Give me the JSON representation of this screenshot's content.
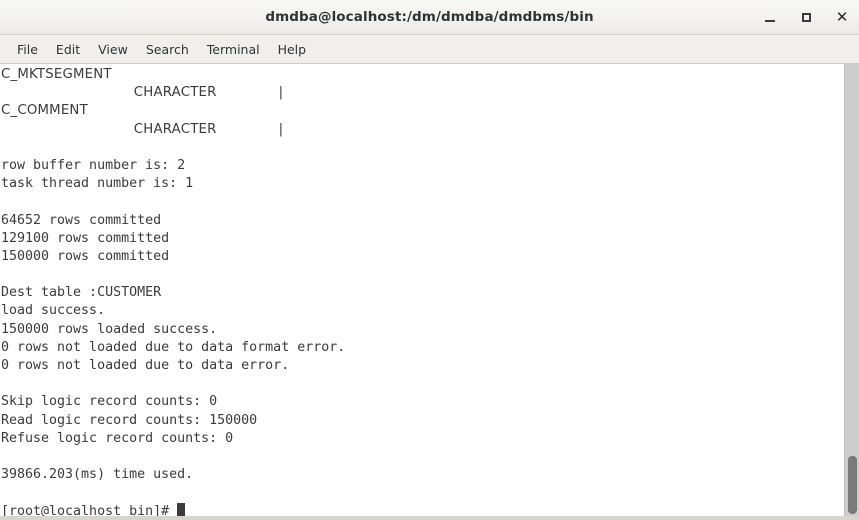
{
  "window": {
    "title": "dmdba@localhost:/dm/dmdba/dmdbms/bin",
    "controls": {
      "minimize": "–",
      "maximize": "□",
      "close": "✕"
    }
  },
  "menubar": {
    "items": [
      {
        "label": "File"
      },
      {
        "label": "Edit"
      },
      {
        "label": "View"
      },
      {
        "label": "Search"
      },
      {
        "label": "Terminal"
      },
      {
        "label": "Help"
      }
    ]
  },
  "terminal": {
    "lines": [
      {
        "text": "C_MKTSEGMENT",
        "style": "hdr"
      },
      {
        "text": "                              CHARACTER              |",
        "style": "hdr"
      },
      {
        "text": "C_COMMENT",
        "style": "hdr"
      },
      {
        "text": "                              CHARACTER              |",
        "style": "hdr"
      },
      {
        "text": "",
        "style": "blank"
      },
      {
        "text": "row buffer number is: 2",
        "style": "mono"
      },
      {
        "text": "task thread number is: 1",
        "style": "mono"
      },
      {
        "text": "",
        "style": "blank"
      },
      {
        "text": "64652 rows committed",
        "style": "mono"
      },
      {
        "text": "129100 rows committed",
        "style": "mono"
      },
      {
        "text": "150000 rows committed",
        "style": "mono"
      },
      {
        "text": "",
        "style": "blank"
      },
      {
        "text": "Dest table :CUSTOMER",
        "style": "mono"
      },
      {
        "text": "load success.",
        "style": "mono"
      },
      {
        "text": "150000 rows loaded success.",
        "style": "mono"
      },
      {
        "text": "0 rows not loaded due to data format error.",
        "style": "mono"
      },
      {
        "text": "0 rows not loaded due to data error.",
        "style": "mono"
      },
      {
        "text": "",
        "style": "blank"
      },
      {
        "text": "Skip logic record counts: 0",
        "style": "mono"
      },
      {
        "text": "Read logic record counts: 150000",
        "style": "mono"
      },
      {
        "text": "Refuse logic record counts: 0",
        "style": "mono"
      },
      {
        "text": "",
        "style": "blank"
      },
      {
        "text": "39866.203(ms) time used.",
        "style": "mono"
      },
      {
        "text": "",
        "style": "blank"
      }
    ],
    "prompt": "[root@localhost bin]# "
  },
  "colors": {
    "terminal_background": "#ffffff",
    "terminal_foreground": "#3b3b3b",
    "titlebar_background": "#f2f1ef",
    "menubar_background": "#f0efed",
    "scrollbar_track": "#cdcdcd",
    "scrollbar_thumb": "#7a7a7a"
  }
}
